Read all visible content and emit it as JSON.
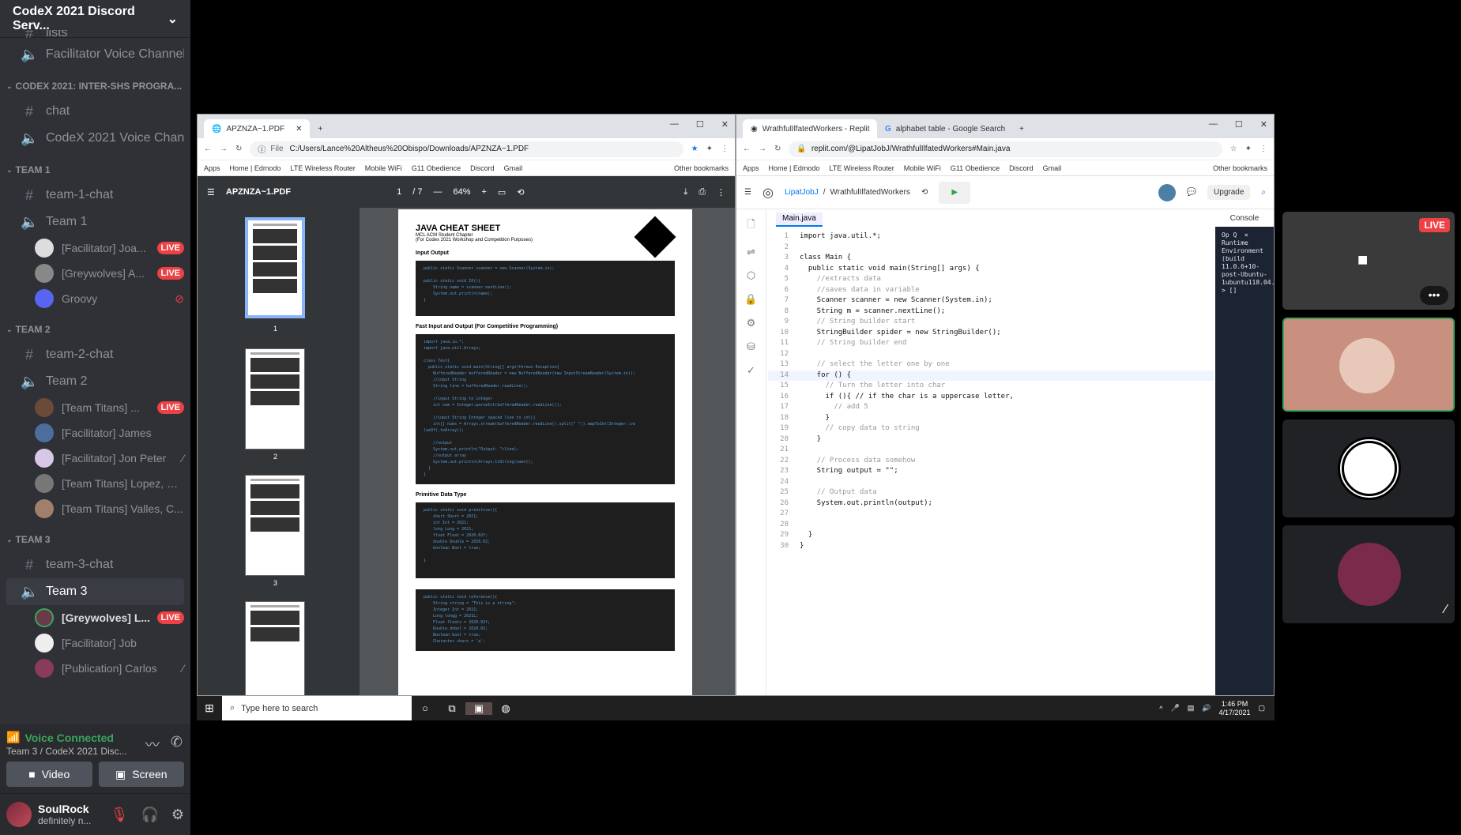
{
  "server": {
    "name": "CodeX 2021 Discord Serv..."
  },
  "channels": {
    "top": [
      {
        "icon": "#",
        "label": "lists"
      },
      {
        "icon": "🔊",
        "label": "Facilitator Voice Channel"
      }
    ],
    "cat1": "CODEX 2021: INTER-SHS PROGRA...",
    "cat1_items": [
      {
        "icon": "#",
        "label": "chat"
      },
      {
        "icon": "🔊",
        "label": "CodeX 2021 Voice Chan..."
      }
    ],
    "team1": "TEAM 1",
    "team1_chat": "team-1-chat",
    "team1_voice": "Team 1",
    "team1_users": [
      {
        "name": "[Facilitator] Joa...",
        "live": "LIVE"
      },
      {
        "name": "[Greywolves] A...",
        "live": "LIVE"
      },
      {
        "name": "Groovy",
        "live": ""
      }
    ],
    "team2": "TEAM 2",
    "team2_chat": "team-2-chat",
    "team2_voice": "Team 2",
    "team2_users": [
      {
        "name": "[Team Titans] ...",
        "live": "LIVE"
      },
      {
        "name": "[Facilitator] James",
        "live": ""
      },
      {
        "name": "[Facilitator] Jon Peter",
        "live": ""
      },
      {
        "name": "[Team Titans] Lopez, M...",
        "live": ""
      },
      {
        "name": "[Team Titans] Valles, C...",
        "live": ""
      }
    ],
    "team3": "TEAM 3",
    "team3_chat": "team-3-chat",
    "team3_voice": "Team 3",
    "team3_users": [
      {
        "name": "[Greywolves] L...",
        "live": "LIVE"
      },
      {
        "name": "[Facilitator] Job",
        "live": ""
      },
      {
        "name": "[Publication] Carlos",
        "live": ""
      }
    ]
  },
  "voice": {
    "status": "Voice Connected",
    "location": "Team 3 / CodeX 2021 Disc...",
    "video": "Video",
    "screen": "Screen"
  },
  "user": {
    "name": "SoulRock",
    "status": "definitely n..."
  },
  "pdf": {
    "tab": "APZNZA~1.PDF",
    "url_prefix": "File",
    "url": "C:/Users/Lance%20Altheus%20Obispo/Downloads/APZNZA~1.PDF",
    "bookmarks": [
      "Apps",
      "Home | Edmodo",
      "LTE Wireless Router",
      "Mobile WiFi",
      "G11 Obedience",
      "Discord",
      "Gmail"
    ],
    "other_bookmarks": "Other bookmarks",
    "title": "APZNZA~1.PDF",
    "page": "1",
    "pages": "/ 7",
    "zoom": "64%",
    "thumb_labels": [
      "1",
      "2",
      "3"
    ],
    "doc_title": "JAVA CHEAT SHEET",
    "doc_sub1": "MCL ACM Student Chapter",
    "doc_sub2": "(For Codex 2021 Workshop and Competition Purposes)",
    "sec1": "Input Output",
    "sec2": "Fast Input and Output (For Competitive Programming)",
    "sec3": "Primitive Data Type",
    "code1": "public static Scanner scanner = new Scanner(System.in);\n\npublic static void IO(){\n    String name = scanner.nextLine();\n    System.out.println(name);\n}",
    "code2": "import java.io.*;\nimport java.util.Arrays;\n\nclass Test{\n  public static void main(String[] args)throws Exception{\n    BufferedReader bufferedReader = new BufferedReader(new InputStreamReader(System.in));\n    //input String\n    String line = bufferedReader.readLine();\n\n    //input String to integer\n    int num = Integer.parseInt(bufferedReader.readLine());\n\n    //input String Integer spaced line to int[]\n    int[] nums = Arrays.stream(bufferedReader.readLine().split(\" \")).mapToInt(Integer::va\nlueOf).toArray();\n\n    //output\n    System.out.println(\"Output: \"+line);\n    //output array\n    System.out.println(Arrays.toString(nums));\n  }\n}",
    "code3": "public static void primitive(){\n    short Short = 2021;\n    int Int = 2021;\n    long Long = 2021;\n    float Float = 2020.02f;\n    double Double = 2020.02;\n    boolean Bool = true;\n\n}",
    "code4": "public static void reference(){\n    String string = \"This is a string\";\n    Integer Int = 2021;\n    Long longg = 2021L;\n    Float floatz = 2020.02f;\n    Double dobol = 2020.02;\n    Boolean bool = true;\n    Character chars = 'a';"
  },
  "replit": {
    "tab1": "WrathfulIlfatedWorkers - Replit",
    "tab2": "alphabet table - Google Search",
    "url": "replit.com/@LipatJobJ/WrathfulIlfatedWorkers#Main.java",
    "bookmarks": [
      "Apps",
      "Home | Edmodo",
      "LTE Wireless Router",
      "Mobile WiFi",
      "G11 Obedience",
      "Discord",
      "Gmail"
    ],
    "other_bookmarks": "Other bookmarks",
    "user": "LipatJobJ",
    "sep": "/",
    "repl": "WrathfulIlfatedWorkers",
    "upgrade": "Upgrade",
    "file": "Main.java",
    "console_label": "Console",
    "console_text": "Op Q  ×\nRuntime Environment (build 11.0.6+10-post-Ubuntu-1ubuntu118.04.1)\n> []",
    "code": [
      {
        "n": "1",
        "t": "import java.util.*;",
        "c": "ctext"
      },
      {
        "n": "2",
        "t": "",
        "c": "ctext"
      },
      {
        "n": "3",
        "t": "class Main {",
        "c": "ctext"
      },
      {
        "n": "4",
        "t": "  public static void main(String[] args) {",
        "c": "ctext"
      },
      {
        "n": "5",
        "t": "    //extracts data",
        "c": "cm"
      },
      {
        "n": "6",
        "t": "    //saves data in variable",
        "c": "cm"
      },
      {
        "n": "7",
        "t": "    Scanner scanner = new Scanner(System.in);",
        "c": "ctext"
      },
      {
        "n": "8",
        "t": "    String m = scanner.nextLine();",
        "c": "ctext"
      },
      {
        "n": "9",
        "t": "    // String builder start",
        "c": "cm"
      },
      {
        "n": "10",
        "t": "    StringBuilder spider = new StringBuilder();",
        "c": "ctext"
      },
      {
        "n": "11",
        "t": "    // String builder end",
        "c": "cm"
      },
      {
        "n": "12",
        "t": "",
        "c": "ctext"
      },
      {
        "n": "13",
        "t": "    // select the letter one by one",
        "c": "cm"
      },
      {
        "n": "14",
        "t": "    for () {",
        "c": "ctext"
      },
      {
        "n": "15",
        "t": "      // Turn the letter into char",
        "c": "cm"
      },
      {
        "n": "16",
        "t": "      if (){ // if the char is a uppercase letter,",
        "c": "ctext"
      },
      {
        "n": "17",
        "t": "        // add 5",
        "c": "cm"
      },
      {
        "n": "18",
        "t": "      }",
        "c": "ctext"
      },
      {
        "n": "19",
        "t": "      // copy data to string",
        "c": "cm"
      },
      {
        "n": "20",
        "t": "    }",
        "c": "ctext"
      },
      {
        "n": "21",
        "t": "",
        "c": "ctext"
      },
      {
        "n": "22",
        "t": "    // Process data somehow",
        "c": "cm"
      },
      {
        "n": "23",
        "t": "    String output = \"\";",
        "c": "ctext"
      },
      {
        "n": "24",
        "t": "",
        "c": "ctext"
      },
      {
        "n": "25",
        "t": "    // Output data",
        "c": "cm"
      },
      {
        "n": "26",
        "t": "    System.out.println(output);",
        "c": "ctext"
      },
      {
        "n": "27",
        "t": "",
        "c": "ctext"
      },
      {
        "n": "28",
        "t": "",
        "c": "ctext"
      },
      {
        "n": "29",
        "t": "  }",
        "c": "ctext"
      },
      {
        "n": "30",
        "t": "}",
        "c": "ctext"
      }
    ]
  },
  "taskbar": {
    "search": "Type here to search",
    "time": "1:46 PM",
    "date": "4/17/2021"
  },
  "tiles": {
    "live": "LIVE"
  }
}
